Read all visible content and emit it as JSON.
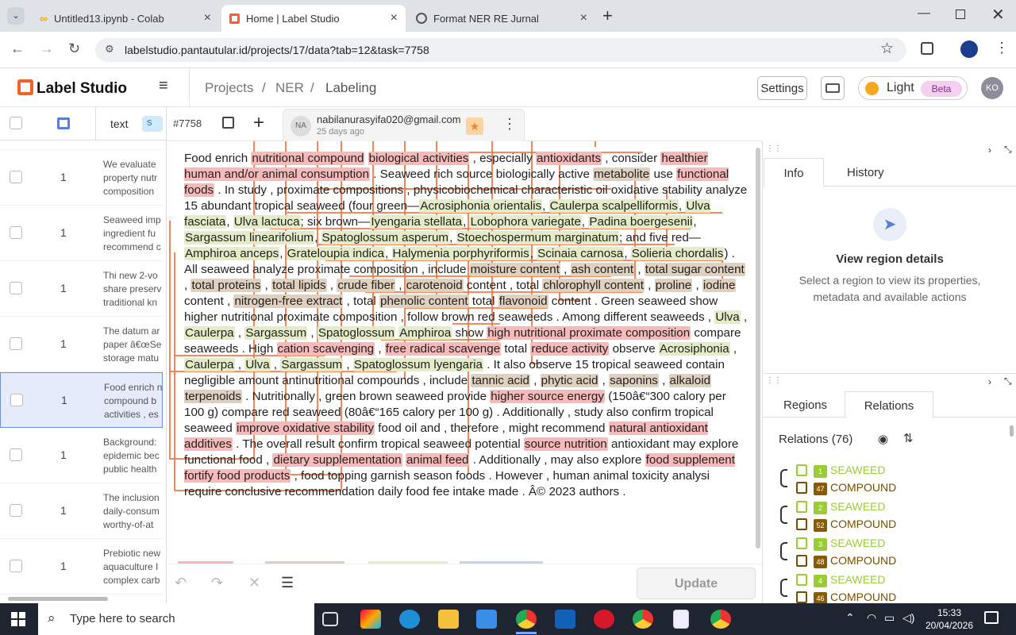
{
  "browser": {
    "tabs": [
      {
        "title": "Untitled13.ipynb - Colab",
        "icon": "colab-icon"
      },
      {
        "title": "Home | Label Studio",
        "icon": "label-studio-icon"
      },
      {
        "title": "Format NER RE Jurnal",
        "icon": "globe-icon"
      }
    ],
    "url": "labelstudio.pantautular.id/projects/17/data?tab=12&task=7758"
  },
  "app": {
    "name": "Label Studio",
    "breadcrumb": [
      "Projects",
      "NER",
      "Labeling"
    ],
    "settings_label": "Settings",
    "theme_label": "Light",
    "beta_label": "Beta",
    "avatar": "KO"
  },
  "table": {
    "col_text": "text",
    "col_tag": "s",
    "rows": [
      {
        "count": "1",
        "text": "We evaluate property nutr composition"
      },
      {
        "count": "1",
        "text": "Seaweed imp ingredient fu recommend c"
      },
      {
        "count": "1",
        "text": "Thi new 2-vo share preserv traditional kn"
      },
      {
        "count": "1",
        "text": "The datum ar paper â€œSe storage matu"
      },
      {
        "count": "1",
        "text": "Food enrich n compound b activities , es"
      },
      {
        "count": "1",
        "text": "Background: epidemic bec public health"
      },
      {
        "count": "1",
        "text": "The inclusion daily-consum worthy-of-at"
      },
      {
        "count": "1",
        "text": "Prebiotic new aquaculture I complex carb"
      }
    ]
  },
  "task": {
    "id": "#7758",
    "annotator_initials": "NA",
    "annotator": "nabilanurasyifa020@gmail.com",
    "time": "25 days ago"
  },
  "text_segments": [
    [
      "Food enrich ",
      ""
    ],
    [
      "nutritional compound",
      "p"
    ],
    [
      " ",
      ""
    ],
    [
      "biological activities",
      "p"
    ],
    [
      " , especially ",
      ""
    ],
    [
      "antioxidants",
      "p"
    ],
    [
      " , consider ",
      ""
    ],
    [
      "healthier human and/or animal consumption",
      "p"
    ],
    [
      " . Seaweed rich source biologically active ",
      ""
    ],
    [
      "metabolite",
      "b"
    ],
    [
      " use ",
      ""
    ],
    [
      "functional foods",
      "p"
    ],
    [
      " . In study , proximate compositions , physicobiochemical characteristic oil oxidative stability analyze 15 abundant tropical seaweed (four green—",
      ""
    ],
    [
      "Acrosiphonia orientalis",
      "g"
    ],
    [
      ", ",
      ""
    ],
    [
      "Caulerpa scalpelliformis",
      "g"
    ],
    [
      ", ",
      ""
    ],
    [
      "Ulva fasciata",
      "g"
    ],
    [
      ", ",
      ""
    ],
    [
      "Ulva lactuca",
      "g"
    ],
    [
      "; six brown—",
      ""
    ],
    [
      "Iyengaria stellata",
      "g"
    ],
    [
      ", ",
      ""
    ],
    [
      "Lobophora variegate",
      "g"
    ],
    [
      ", ",
      ""
    ],
    [
      "Padina boergesenii",
      "g"
    ],
    [
      ", ",
      ""
    ],
    [
      "Sargassum linearifolium",
      "g"
    ],
    [
      ", ",
      ""
    ],
    [
      "Spatoglossum asperum",
      "g"
    ],
    [
      ", ",
      ""
    ],
    [
      "Stoechospermum marginatum",
      "g"
    ],
    [
      "; and five red—",
      ""
    ],
    [
      "Amphiroa anceps",
      "g"
    ],
    [
      ", ",
      ""
    ],
    [
      "Grateloupia indica",
      "g"
    ],
    [
      ", ",
      ""
    ],
    [
      "Halymenia porphyriformis",
      "g"
    ],
    [
      ", ",
      ""
    ],
    [
      "Scinaia carnosa",
      "g"
    ],
    [
      ", ",
      ""
    ],
    [
      "Solieria chordalis",
      "g"
    ],
    [
      ") . All seaweed analyze proximate composition , include ",
      ""
    ],
    [
      "moisture content",
      "b"
    ],
    [
      " , ",
      ""
    ],
    [
      "ash content",
      "b"
    ],
    [
      " , ",
      ""
    ],
    [
      "total sugar content",
      "b"
    ],
    [
      " , ",
      ""
    ],
    [
      "total proteins",
      "b"
    ],
    [
      " , ",
      ""
    ],
    [
      "total lipids",
      "b"
    ],
    [
      " , ",
      ""
    ],
    [
      "crude fiber",
      "b"
    ],
    [
      " , ",
      ""
    ],
    [
      "carotenoid",
      "b"
    ],
    [
      " content , total ",
      ""
    ],
    [
      "chlorophyll content",
      "b"
    ],
    [
      " , ",
      ""
    ],
    [
      "proline",
      "b"
    ],
    [
      " , ",
      ""
    ],
    [
      "iodine",
      "b"
    ],
    [
      " content , ",
      ""
    ],
    [
      "nitrogen-free extract",
      "b"
    ],
    [
      " , total ",
      ""
    ],
    [
      "phenolic content",
      "b"
    ],
    [
      " total ",
      ""
    ],
    [
      "flavonoid",
      "b"
    ],
    [
      " content . Green seaweed show higher nutritional proximate composition , follow brown red seaweeds . Among different seaweeds , ",
      ""
    ],
    [
      "Ulva",
      "g"
    ],
    [
      " , ",
      ""
    ],
    [
      "Caulerpa",
      "g"
    ],
    [
      " , ",
      ""
    ],
    [
      "Sargassum",
      "g"
    ],
    [
      " , ",
      ""
    ],
    [
      "Spatoglossum",
      "g"
    ],
    [
      " ",
      ""
    ],
    [
      "Amphiroa",
      "g"
    ],
    [
      " show ",
      ""
    ],
    [
      "high nutritional proximate composition",
      "p"
    ],
    [
      " compare seaweeds . High ",
      ""
    ],
    [
      "cation scavenging",
      "p"
    ],
    [
      " , ",
      ""
    ],
    [
      "free radical scavenge",
      "p"
    ],
    [
      " total ",
      ""
    ],
    [
      "reduce activity",
      "p"
    ],
    [
      " observe ",
      ""
    ],
    [
      "Acrosiphonia",
      "g"
    ],
    [
      " , ",
      ""
    ],
    [
      "Caulerpa",
      "g"
    ],
    [
      " , ",
      ""
    ],
    [
      "Ulva",
      "g"
    ],
    [
      " , ",
      ""
    ],
    [
      "Sargassum",
      "g"
    ],
    [
      " , ",
      ""
    ],
    [
      "Spatoglossum lyengaria",
      "g"
    ],
    [
      " . It also observe 15 tropical seaweed contain negligible amount antinutritional compounds , include ",
      ""
    ],
    [
      "tannic acid",
      "b"
    ],
    [
      " , ",
      ""
    ],
    [
      "phytic acid",
      "b"
    ],
    [
      " , ",
      ""
    ],
    [
      "saponins",
      "b"
    ],
    [
      " , ",
      ""
    ],
    [
      "alkaloid",
      "b"
    ],
    [
      " ",
      ""
    ],
    [
      "terpenoids",
      "b"
    ],
    [
      " . Nutritionally , green brown seaweed provide ",
      ""
    ],
    [
      "higher source energy",
      "p"
    ],
    [
      " (150â€“300 calory per 100 g) compare red seaweed (80â€“165 calory per 100 g) . Additionally , study also confirm tropical seaweed ",
      ""
    ],
    [
      "improve oxidative stability",
      "p"
    ],
    [
      " food oil and , therefore , might recommend ",
      ""
    ],
    [
      "natural antioxidant additives",
      "p"
    ],
    [
      " . The overall result confirm tropical seaweed potential ",
      ""
    ],
    [
      "source nutrition",
      "p"
    ],
    [
      " antioxidant may explore functional food , ",
      ""
    ],
    [
      "dietary supplementation",
      "p"
    ],
    [
      " ",
      ""
    ],
    [
      "animal feed",
      "p"
    ],
    [
      " . Additionally , may also explore ",
      ""
    ],
    [
      "food supplement fortify food products",
      "p"
    ],
    [
      " , food topping garnish season foods . However , human animal toxicity analysi require conclusive recommendation daily food fee intake made . Â© 2023 authors .",
      ""
    ]
  ],
  "update_label": "Update",
  "side_panel": {
    "tabs": [
      "Info",
      "History"
    ],
    "empty_title": "View region details",
    "empty_desc": "Select a region to view its properties, metadata and available actions",
    "lower_tabs": [
      "Regions",
      "Relations"
    ],
    "relations_title": "Relations (76)",
    "relations": [
      {
        "from_id": "1",
        "from_label": "SEAWEED",
        "to_id": "47",
        "to_label": "COMPOUND"
      },
      {
        "from_id": "2",
        "from_label": "SEAWEED",
        "to_id": "52",
        "to_label": "COMPOUND"
      },
      {
        "from_id": "3",
        "from_label": "SEAWEED",
        "to_id": "48",
        "to_label": "COMPOUND"
      },
      {
        "from_id": "4",
        "from_label": "SEAWEED",
        "to_id": "46",
        "to_label": "COMPOUND"
      }
    ],
    "colors": {
      "seaweed": "#9acd32",
      "compound": "#8b5a00"
    }
  },
  "taskbar": {
    "search_placeholder": "Type here to search",
    "time": "15:33",
    "date": "20/04/2026"
  }
}
